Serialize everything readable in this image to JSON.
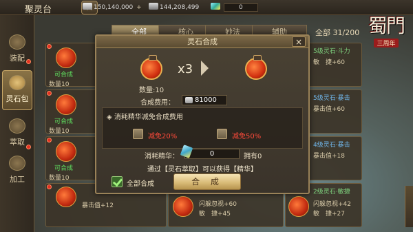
{
  "topbar": {
    "title": "聚灵台",
    "close": "×",
    "currencies": [
      {
        "icon": "silver-icon",
        "value": "150,140,000"
      },
      {
        "icon": "gold-icon",
        "value": "144,208,499"
      },
      {
        "icon": "essence-icon",
        "value": "0"
      }
    ]
  },
  "sidebar": {
    "items": [
      {
        "label": "装配",
        "active": false
      },
      {
        "label": "灵石包",
        "active": true
      },
      {
        "label": "萃取",
        "active": false
      },
      {
        "label": "加工",
        "active": false
      }
    ]
  },
  "tabs": [
    "全部",
    "核心",
    "妙法",
    "辅助"
  ],
  "tabs_active": 0,
  "count": "全部 31/200",
  "logo": {
    "main": "蜀門",
    "sub": "三周年"
  },
  "cards": {
    "left": [
      {
        "status": "可合成",
        "qty": "数量10"
      },
      {
        "status": "可合成",
        "qty": "数量10"
      },
      {
        "status": "可合成",
        "qty": "数量10"
      },
      {
        "status": "",
        "qty": "",
        "stat": "暴击值+12"
      }
    ],
    "right": [
      {
        "name": "5级灵石·斗力",
        "line1": "敏　捷+60"
      },
      {
        "name": "5级灵石·暴击",
        "line1": "暴击值+60"
      },
      {
        "name": "4级灵石·暴击",
        "line1": "暴击值+18"
      },
      {
        "name": "2级灵石·敏捷",
        "line1": "敏　捷+27"
      }
    ],
    "mid": [
      {
        "line1": "闪躲忽视+60",
        "line2": "敏　捷+45"
      },
      {
        "line1": "闪躲忽视+42",
        "line2": "敏　捷+27"
      }
    ]
  },
  "modal": {
    "title": "灵石合成",
    "close": "×",
    "multiplier": "x3",
    "quantity": "数量:10",
    "fee_label": "合成费用：",
    "fee_value": "81000",
    "section_title": "◈ 消耗精华减免合成费用",
    "options": [
      {
        "label": "减免20%",
        "checked": false
      },
      {
        "label": "减免50%",
        "checked": false
      }
    ],
    "essence_label": "消耗精华：",
    "essence_value": "0",
    "own_label": "拥有0",
    "hint": "通过【灵石萃取】可以获得【精华】",
    "all_combine_label": "全部合成",
    "all_combine_checked": true,
    "combine_button": "合 成"
  },
  "colors": {
    "accent": "#c9a867",
    "warning": "#ff4a3a",
    "ok": "#5fe05f"
  }
}
